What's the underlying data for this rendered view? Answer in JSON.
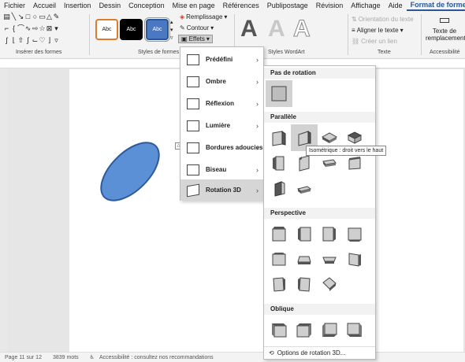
{
  "menubar": {
    "tabs": [
      "Fichier",
      "Accueil",
      "Insertion",
      "Dessin",
      "Conception",
      "Mise en page",
      "Références",
      "Publipostage",
      "Révision",
      "Affichage",
      "Aide",
      "Format de forme"
    ],
    "active_tab": "Format de forme"
  },
  "ribbon": {
    "groups": {
      "insert_shapes": "Insérer des formes",
      "shape_styles": "Styles de formes",
      "wordart_styles": "Styles WordArt",
      "text": "Texte",
      "accessibility": "Accessibilité"
    },
    "style_samples": [
      "Abc",
      "Abc",
      "Abc"
    ],
    "fill_label": "Remplissage",
    "outline_label": "Contour",
    "effects_label": "Effets",
    "wordart_letters": [
      "A",
      "A",
      "A"
    ],
    "text_direction": "Orientation du texte",
    "align_text": "Aligner le texte",
    "create_link": "Créer un lien",
    "alt_text_line1": "Texte de",
    "alt_text_line2": "remplacement"
  },
  "effects_menu": {
    "items": [
      {
        "label": "Prédéfini"
      },
      {
        "label": "Ombre"
      },
      {
        "label": "Réflexion"
      },
      {
        "label": "Lumière"
      },
      {
        "label": "Bordures adoucies"
      },
      {
        "label": "Biseau"
      },
      {
        "label": "Rotation 3D"
      }
    ],
    "highlighted": "Rotation 3D"
  },
  "rotation_panel": {
    "sections": {
      "none": "Pas de rotation",
      "parallel": "Parallèle",
      "perspective": "Perspective",
      "oblique": "Oblique"
    },
    "tooltip": "Isométrique : droit vers le haut",
    "options_link": "Options de rotation 3D..."
  },
  "statusbar": {
    "page": "Page 11 sur 12",
    "words": "3839 mots",
    "accessibility": "Accessibilité : consultez nos recommandations"
  },
  "colors": {
    "accent": "#2b5797",
    "ellipse_fill": "#5b8fd6",
    "ellipse_stroke": "#2d5a9a",
    "highlight": "#d6d6d6"
  }
}
